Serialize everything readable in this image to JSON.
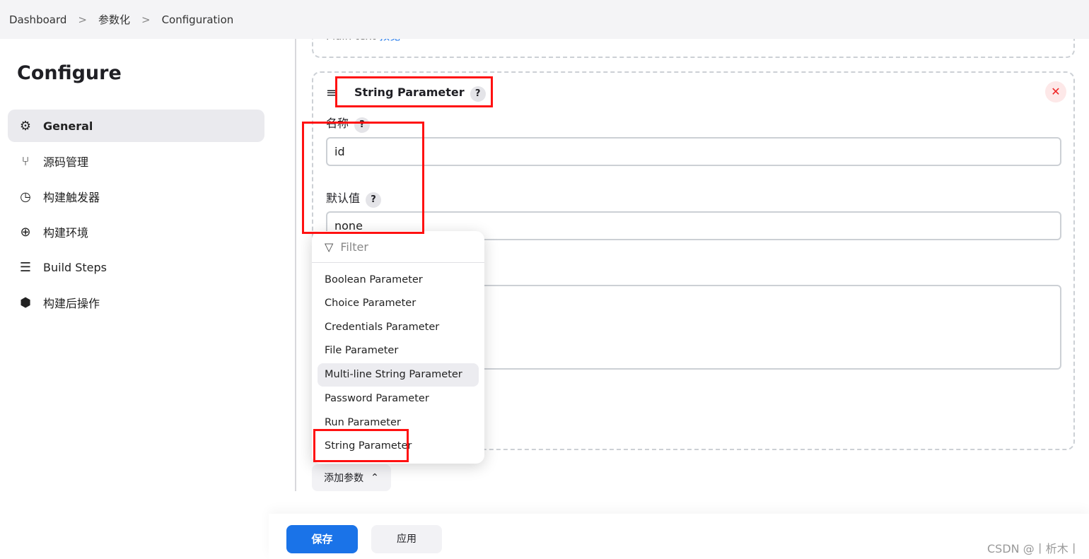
{
  "breadcrumb": [
    "Dashboard",
    "参数化",
    "Configuration"
  ],
  "page_title": "Configure",
  "sidebar": {
    "items": [
      {
        "label": "General",
        "icon": "gear-icon",
        "active": true
      },
      {
        "label": "源码管理",
        "icon": "branch-icon"
      },
      {
        "label": "构建触发器",
        "icon": "timer-icon"
      },
      {
        "label": "构建环境",
        "icon": "globe-icon"
      },
      {
        "label": "Build Steps",
        "icon": "list-icon"
      },
      {
        "label": "构建后操作",
        "icon": "package-icon"
      }
    ]
  },
  "prev_card": {
    "text": "Plain text",
    "link": "预览"
  },
  "param": {
    "title": "String Parameter",
    "help": "?",
    "name_label": "名称",
    "name_value": "id",
    "default_label": "默认值",
    "default_value": "none"
  },
  "menu": {
    "filter_placeholder": "Filter",
    "items": [
      "Boolean Parameter",
      "Choice Parameter",
      "Credentials Parameter",
      "File Parameter",
      "Multi-line String Parameter",
      "Password Parameter",
      "Run Parameter",
      "String Parameter"
    ],
    "highlighted": "Multi-line String Parameter"
  },
  "add_button": "添加参数",
  "save": "保存",
  "apply": "应用",
  "watermark": "CSDN @丨析木丨",
  "colors": {
    "primary": "#1a73e8",
    "annotation": "#ff1111"
  }
}
